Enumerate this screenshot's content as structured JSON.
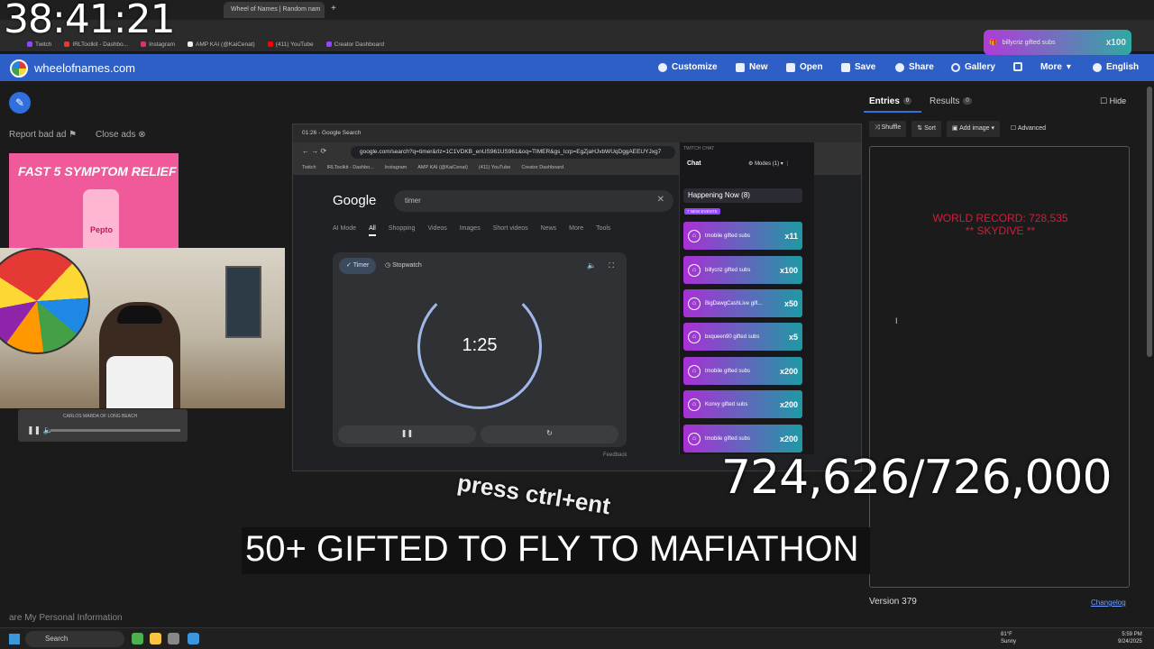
{
  "overlay": {
    "clock": "38:41:21",
    "goal_counter": "724,626/726,000",
    "subtitle": "50+ GIFTED TO FLY TO MAFIATHON",
    "press_text": "press ctrl+ent",
    "top_alert": {
      "text": "billycriz gifted subs",
      "count": "x100"
    }
  },
  "browser": {
    "tabs": [
      "Wheel of Names | Random nam"
    ],
    "bookmarks": [
      "Twitch",
      "IRLToolkit - Dashbo...",
      "Instagram",
      "AMP KAI (@KaiCenat)",
      "(411) YouTube",
      "Creator Dashboard"
    ]
  },
  "site": {
    "title": "wheelofnames.com",
    "nav": [
      "Customize",
      "New",
      "Open",
      "Save",
      "Share",
      "Gallery",
      "More",
      "English"
    ]
  },
  "left": {
    "report_ad": "Report bad ad",
    "close_ads": "Close ads",
    "ad_headline": "FAST 5 SYMPTOM RELIEF",
    "ad_brand": "Pepto",
    "privacy": "are My Personal Information",
    "mini_player_caption": "CARLOS MARDA OF LONG BEACH"
  },
  "google_window": {
    "tab_title": "01:26 - Google Search",
    "url": "google.com/search?q=timer&rlz=1C1VDKB_enUS961US961&oq=TIMER&gs_lcrp=EgZjaHJvbWUqDggAEEUYJxg7",
    "bookmarks": [
      "Twitch",
      "IRLToolkit - Dashbo...",
      "Instagram",
      "AMP KAI (@KaiCenat)",
      "(411) YouTube",
      "Creator Dashboard"
    ],
    "logo": "Google",
    "query": "timer",
    "filters": [
      "AI Mode",
      "All",
      "Shopping",
      "Videos",
      "Images",
      "Short videos",
      "News",
      "More",
      "Tools"
    ],
    "timer_tab": "Timer",
    "stopwatch_tab": "Stopwatch",
    "timer_value": "1:25",
    "feedback": "Feedback"
  },
  "chat": {
    "header": "TWITCH CHAT",
    "title": "Chat",
    "modes": "Modes (1)",
    "happening": "Happening Now (8)",
    "new_events": "7 NEW EVENTS",
    "gifts": [
      {
        "text": "tmobile gifted subs",
        "count": "x11"
      },
      {
        "text": "billycriz gifted subs",
        "count": "x100"
      },
      {
        "text": "BigDawgCashLive gift...",
        "count": "x50"
      },
      {
        "text": "bxqueen90 gifted subs",
        "count": "x5"
      },
      {
        "text": "tmobile gifted subs",
        "count": "x200"
      },
      {
        "text": "Konvy gifted subs",
        "count": "x200"
      },
      {
        "text": "tmobile gifted subs",
        "count": "x200"
      }
    ]
  },
  "right_panel": {
    "entries_label": "Entries",
    "entries_count": "0",
    "results_label": "Results",
    "results_count": "0",
    "hide": "Hide",
    "toolbar": [
      "Shuffle",
      "Sort",
      "Add image",
      "Advanced"
    ],
    "entry_line1": "WORLD RECORD: 728,535",
    "entry_line2": "** SKYDIVE **",
    "version": "Version 379",
    "changelog": "Changelog"
  },
  "taskbar": {
    "search": "Search",
    "weather_temp": "81°F",
    "weather_desc": "Sunny",
    "time": "5:59 PM",
    "date": "9/24/2025"
  },
  "colors": {
    "site_blue": "#2e5fc7",
    "gift_gradient_start": "#a930d6",
    "gift_gradient_end": "#1e9aa4",
    "world_record_red": "#d81b3a"
  }
}
